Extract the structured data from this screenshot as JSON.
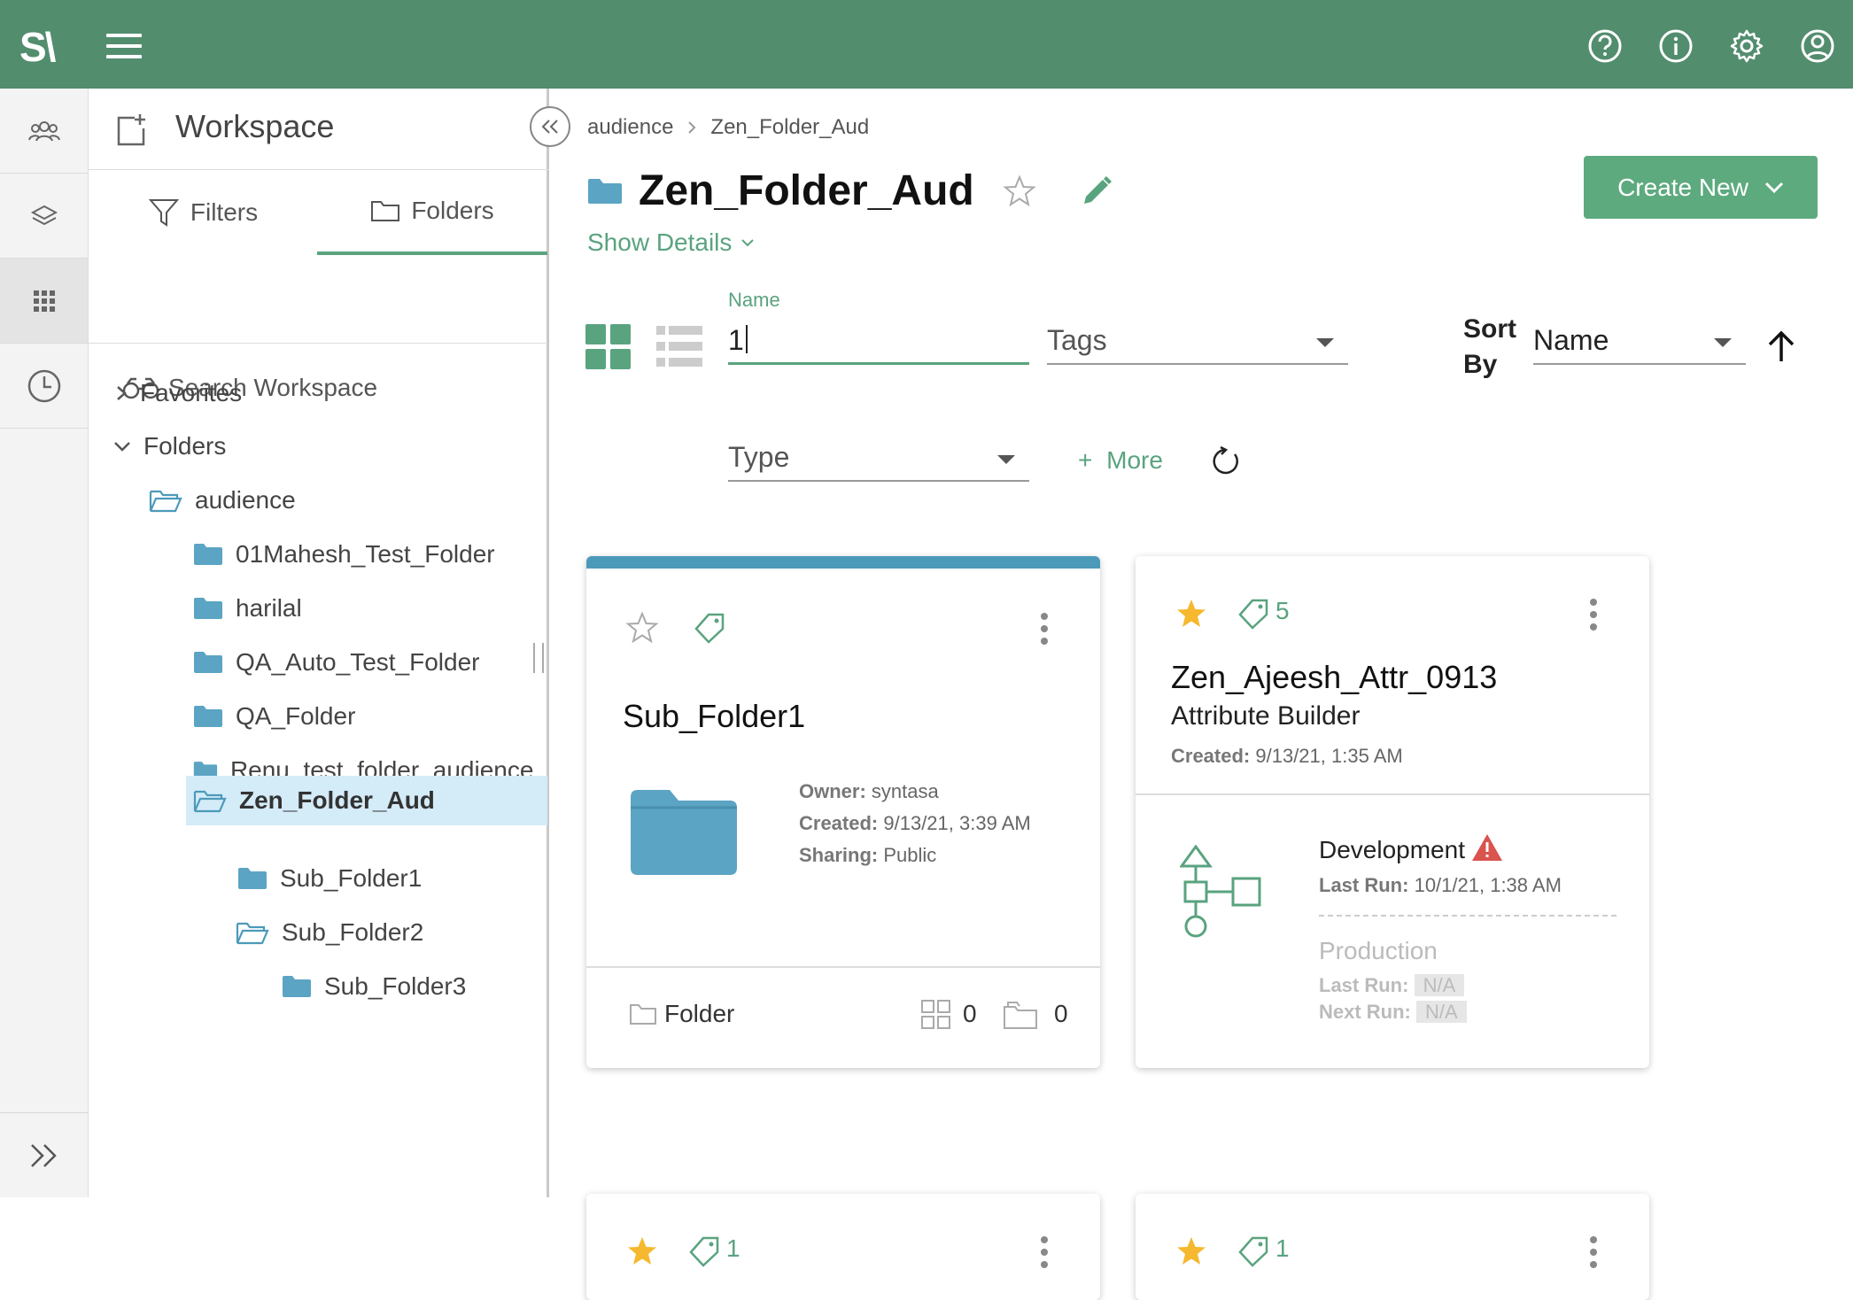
{
  "app": {
    "logo_text": "S\\"
  },
  "top_icons": [
    "help-icon",
    "info-icon",
    "settings-icon",
    "account-icon"
  ],
  "rail": {
    "items": [
      "users-icon",
      "layers-icon",
      "apps-grid-icon",
      "history-icon"
    ],
    "expand_icon": "expand-icon"
  },
  "workspace": {
    "title": "Workspace",
    "tabs": [
      {
        "label": "Filters"
      },
      {
        "label": "Folders"
      }
    ],
    "search_label": "Search Workspace",
    "tree": {
      "favorites": "Favorites",
      "folders": "Folders",
      "audience": "audience",
      "children": [
        "01Mahesh_Test_Folder",
        "harilal",
        "QA_Auto_Test_Folder",
        "QA_Folder",
        "Renu_test_folder_audience_"
      ],
      "selected": "Zen_Folder_Aud",
      "sub1": "Sub_Folder1",
      "sub2": "Sub_Folder2",
      "sub3": "Sub_Folder3"
    }
  },
  "breadcrumb": [
    "audience",
    "Zen_Folder_Aud"
  ],
  "page": {
    "title": "Zen_Folder_Aud",
    "show_details": "Show Details",
    "create_new": "Create New"
  },
  "filters": {
    "name_label": "Name",
    "name_value": "1",
    "tags_placeholder": "Tags",
    "sort_by_label_1": "Sort",
    "sort_by_label_2": "By",
    "sort_value": "Name",
    "type_placeholder": "Type",
    "more_label": "More",
    "more_plus": "+"
  },
  "cards": [
    {
      "title": "Sub_Folder1",
      "owner_label": "Owner:",
      "owner": "syntasa",
      "created_label": "Created:",
      "created": "9/13/21, 3:39 AM",
      "sharing_label": "Sharing:",
      "sharing": "Public",
      "footer_type": "Folder",
      "app_count": "0",
      "folder_count": "0",
      "accent_color": "#4c9aba"
    },
    {
      "title": "Zen_Ajeesh_Attr_0913",
      "subtitle": "Attribute Builder",
      "tag_count": "5",
      "created_label": "Created:",
      "created": "9/13/21, 1:35 AM",
      "development": "Development",
      "dev_last_run_label": "Last Run:",
      "dev_last_run": "10/1/21, 1:38 AM",
      "production": "Production",
      "prod_last_run_label": "Last Run:",
      "prod_last_run": "N/A",
      "prod_next_run_label": "Next Run:",
      "prod_next_run": "N/A"
    },
    {
      "tag_count": "1"
    },
    {
      "tag_count": "1"
    }
  ],
  "colors": {
    "topbar": "#528d6e",
    "accent": "#5aa37f",
    "folder": "#5ba4c4",
    "warning": "#d9534f",
    "star": "#f5b82e"
  }
}
